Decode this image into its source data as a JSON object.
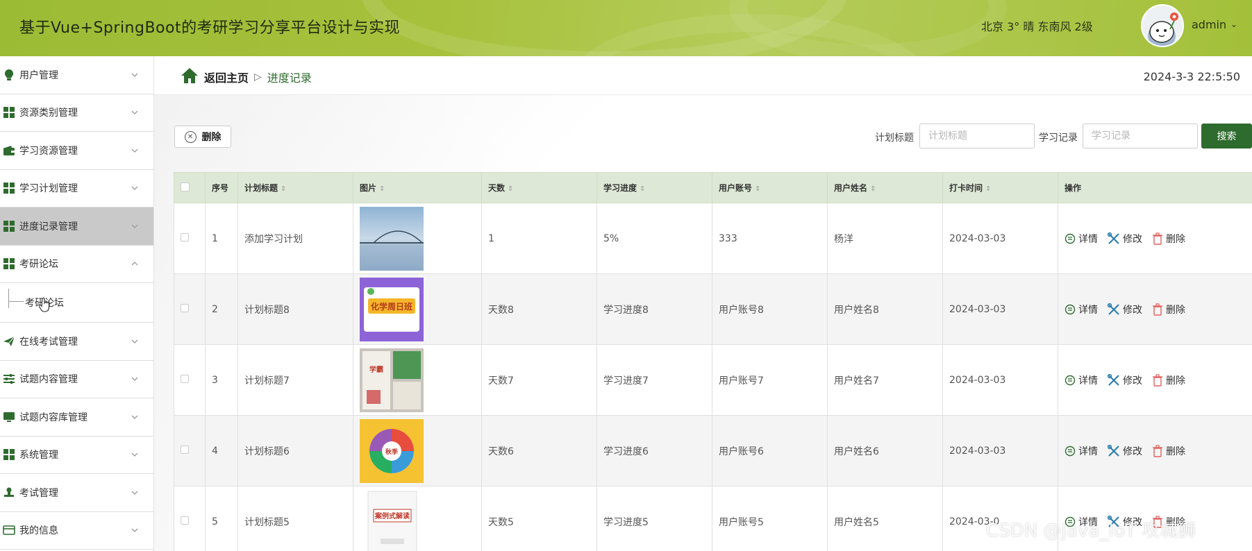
{
  "header": {
    "title": "基于Vue+SpringBoot的考研学习分享平台设计与实现",
    "weather": "北京  3°  晴  东南风  2级",
    "user": "admin",
    "accent_color": "#a3c03a"
  },
  "sidebar": {
    "items": [
      {
        "label": "用户管理",
        "icon": "lightbulb-icon"
      },
      {
        "label": "资源类别管理",
        "icon": "grid-icon"
      },
      {
        "label": "学习资源管理",
        "icon": "wallet-icon"
      },
      {
        "label": "学习计划管理",
        "icon": "grid-icon"
      },
      {
        "label": "进度记录管理",
        "icon": "grid-icon"
      },
      {
        "label": "考研论坛",
        "icon": "grid-icon"
      },
      {
        "label": "在线考试管理",
        "icon": "paper-plane-icon"
      },
      {
        "label": "试题内容管理",
        "icon": "sliders-icon"
      },
      {
        "label": "试题内容库管理",
        "icon": "monitor-icon"
      },
      {
        "label": "系统管理",
        "icon": "grid-icon"
      },
      {
        "label": "考试管理",
        "icon": "stamp-icon"
      },
      {
        "label": "我的信息",
        "icon": "id-card-icon"
      }
    ],
    "sub_item": "考研论坛"
  },
  "breadcrumb": {
    "home": "返回主页",
    "sep": "▷",
    "current": "进度记录"
  },
  "datetime": "2024-3-3 22:5:50",
  "toolbar": {
    "delete_label": "删除",
    "search_btn": "搜索",
    "filter1_label": "计划标题",
    "filter1_placeholder": "计划标题",
    "filter2_label": "学习记录",
    "filter2_placeholder": "学习记录"
  },
  "table": {
    "headers": [
      "序号",
      "计划标题",
      "图片",
      "天数",
      "学习进度",
      "用户账号",
      "用户姓名",
      "打卡时间",
      "操作"
    ],
    "ops": {
      "detail": "详情",
      "edit": "修改",
      "delete": "删除"
    },
    "rows": [
      {
        "no": "1",
        "title": "添加学习计划",
        "days": "1",
        "progress": "5%",
        "account": "333",
        "name": "杨洋",
        "time": "2024-03-03"
      },
      {
        "no": "2",
        "title": "计划标题8",
        "days": "天数8",
        "progress": "学习进度8",
        "account": "用户账号8",
        "name": "用户姓名8",
        "time": "2024-03-03"
      },
      {
        "no": "3",
        "title": "计划标题7",
        "days": "天数7",
        "progress": "学习进度7",
        "account": "用户账号7",
        "name": "用户姓名7",
        "time": "2024-03-03"
      },
      {
        "no": "4",
        "title": "计划标题6",
        "days": "天数6",
        "progress": "学习进度6",
        "account": "用户账号6",
        "name": "用户姓名6",
        "time": "2024-03-03"
      },
      {
        "no": "5",
        "title": "计划标题5",
        "days": "天数5",
        "progress": "学习进度5",
        "account": "用户账号5",
        "name": "用户姓名5",
        "time": "2024-03-0"
      }
    ],
    "thumb_texts": {
      "row2_line1": "化学周日班",
      "row3_line1": "学霸",
      "row4_line1": "秋季",
      "row5_line1": "案例式解读"
    }
  },
  "watermark": "CSDN @Java_IoT 攻城狮"
}
